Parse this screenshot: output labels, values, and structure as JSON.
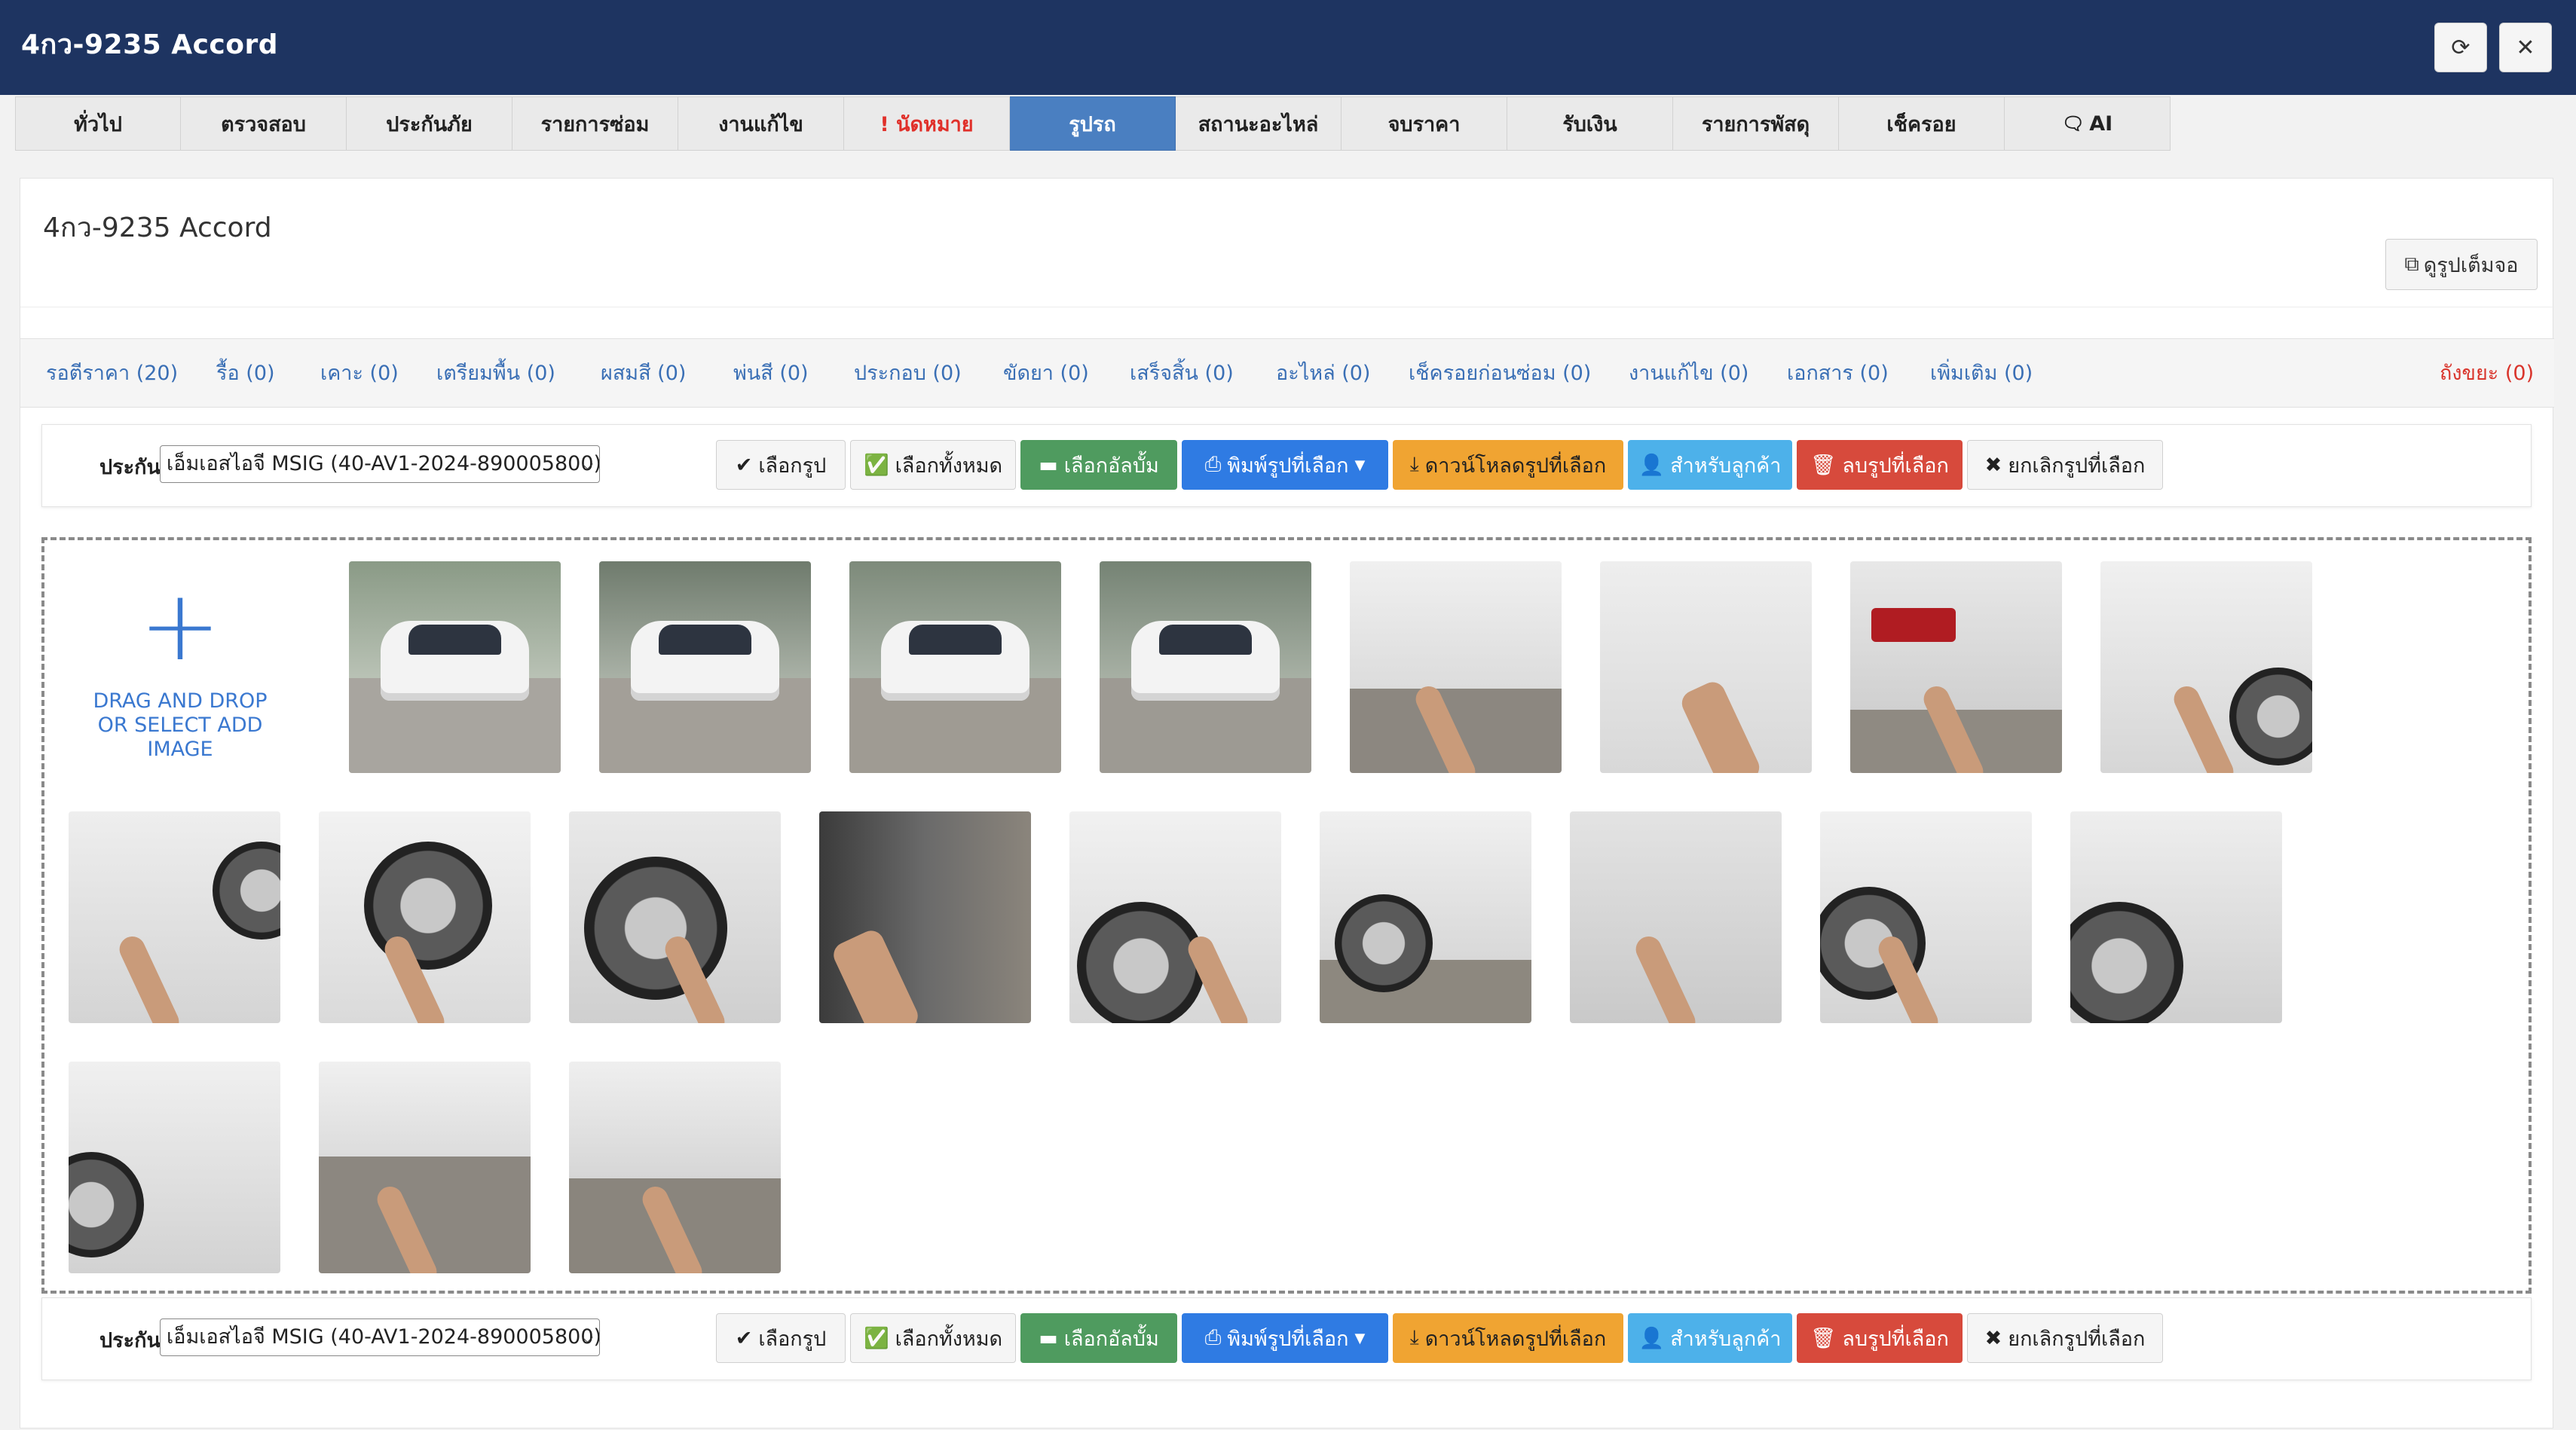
{
  "app": {
    "title": "4กว-9235 Accord",
    "refresh_icon": "refresh-icon",
    "close_icon": "close-icon"
  },
  "tabs": [
    {
      "label": "ทั่วไป"
    },
    {
      "label": "ตรวจสอบ"
    },
    {
      "label": "ประกันภัย"
    },
    {
      "label": "รายการซ่อม"
    },
    {
      "label": "งานแก้ไข"
    },
    {
      "label": "! นัดหมาย",
      "alert": true
    },
    {
      "label": "รูปรถ",
      "active": true
    },
    {
      "label": "สถานะอะไหล่"
    },
    {
      "label": "จบราคา"
    },
    {
      "label": "รับเงิน"
    },
    {
      "label": "รายการพัสดุ"
    },
    {
      "label": "เช็ครอย"
    },
    {
      "label": "AI",
      "icon": "chat-icon"
    }
  ],
  "panel": {
    "title": "4กว-9235 Accord",
    "fullscreen_label": "ดูรูปเต็มจอ"
  },
  "categories": [
    {
      "label": "รอตีราคา (20)"
    },
    {
      "label": "รื้อ (0)"
    },
    {
      "label": "เคาะ (0)"
    },
    {
      "label": "เตรียมพื้น (0)"
    },
    {
      "label": "ผสมสี (0)"
    },
    {
      "label": "พ่นสี (0)"
    },
    {
      "label": "ประกอบ (0)"
    },
    {
      "label": "ขัดยา (0)"
    },
    {
      "label": "เสร็จสิ้น (0)"
    },
    {
      "label": "อะไหล่ (0)"
    },
    {
      "label": "เช็ครอยก่อนซ่อม (0)"
    },
    {
      "label": "งานแก้ไข (0)"
    },
    {
      "label": "เอกสาร (0)"
    },
    {
      "label": "เพิ่มเติม (0)"
    },
    {
      "label": "ถังขยะ (0)",
      "trash": true
    }
  ],
  "toolbar": {
    "insurance_label": "ประกัน",
    "insurance_value": "เอ็มเอสไอจี MSIG (40-AV1-2024-890005800)",
    "buttons": {
      "select": "เลือกรูป",
      "select_all": "เลือกทั้งหมด",
      "select_album": "เลือกอัลบั้ม",
      "print_selected": "พิมพ์รูปที่เลือก",
      "download_selected": "ดาวน์โหลดรูปที่เลือก",
      "for_customer": "สำหรับลูกค้า",
      "delete_selected": "ลบรูปที่เลือก",
      "deselect": "ยกเลิกรูปที่เลือก"
    }
  },
  "dropzone": {
    "line1": "DRAG AND DROP",
    "line2": "OR SELECT ADD IMAGE"
  },
  "colors": {
    "header": "#1e3461",
    "active_tab": "#4a7fc1",
    "alert": "#e0302a",
    "link": "#3a6fb5"
  }
}
